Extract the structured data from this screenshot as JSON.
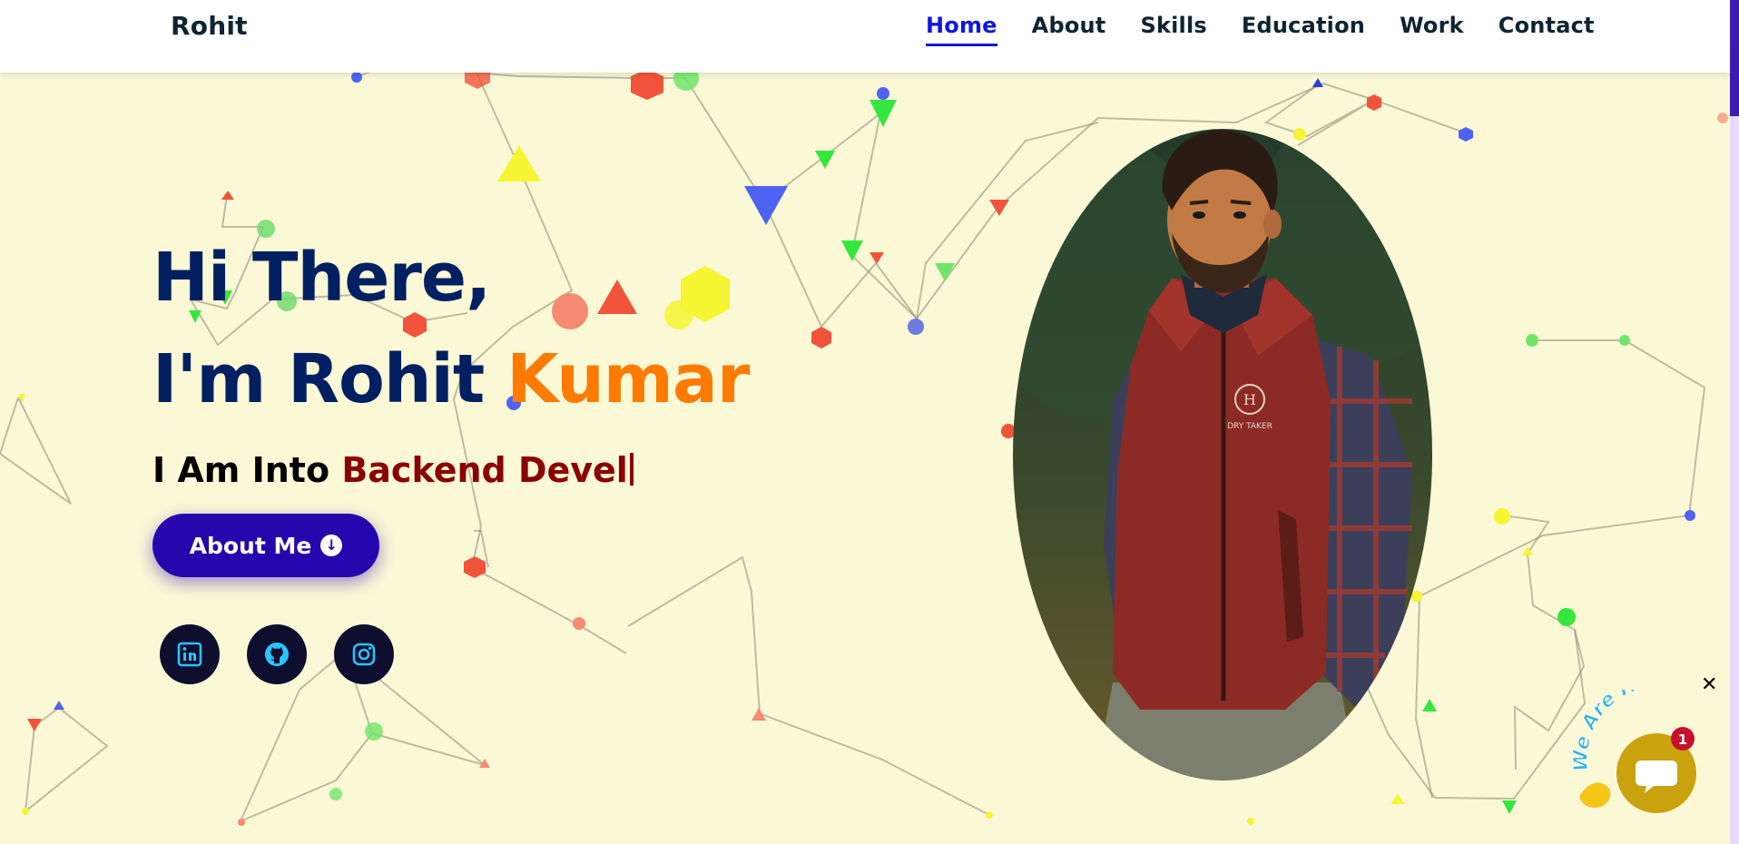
{
  "brand": {
    "logo": "Rohit"
  },
  "nav": {
    "items": [
      {
        "label": "Home",
        "active": true
      },
      {
        "label": "About",
        "active": false
      },
      {
        "label": "Skills",
        "active": false
      },
      {
        "label": "Education",
        "active": false
      },
      {
        "label": "Work",
        "active": false
      },
      {
        "label": "Contact",
        "active": false
      }
    ]
  },
  "hero": {
    "greeting": "Hi There,",
    "intro_prefix": "I'm Rohit",
    "intro_highlight": "Kumar",
    "tagline_prefix": "I Am Into",
    "tagline_typed": "Backend Devel",
    "button_label": "About Me",
    "button_icon": "arrow-circle-down-icon"
  },
  "socials": [
    {
      "name": "linkedin",
      "icon": "linkedin-icon"
    },
    {
      "name": "github",
      "icon": "github-icon"
    },
    {
      "name": "instagram",
      "icon": "instagram-icon"
    }
  ],
  "portrait": {
    "jacket_text": "DRY TAKER",
    "logo_letter": "H"
  },
  "chat": {
    "bubble_text": "We Are Here!",
    "badge_count": "1",
    "close_symbol": "✕"
  },
  "colors": {
    "background": "#fbf8d6",
    "navy": "#012061",
    "accent_orange": "#ff7a00",
    "nav_active": "#0f18e0",
    "typed_text": "#8b0000",
    "button": "#2506ad",
    "social_bg": "#0e0e2e",
    "social_icon": "#27c5ff",
    "chat_gold": "#c9a20e"
  }
}
